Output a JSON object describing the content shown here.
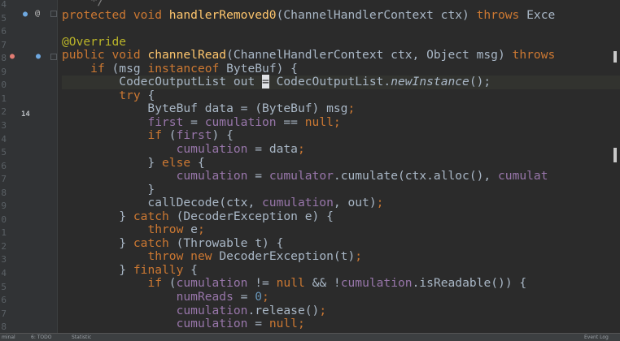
{
  "gutter": {
    "line_numbers": [
      "4",
      "5",
      "6",
      "7",
      "8",
      "9",
      "0",
      "1",
      "2",
      "3",
      "4",
      "5",
      "6",
      "7",
      "8",
      "9",
      "0",
      "1",
      "2",
      "3",
      "4",
      "5",
      "6",
      "7",
      "8"
    ],
    "badge": "14"
  },
  "code": {
    "lines": [
      [
        {
          "t": "    */",
          "c": "cm"
        }
      ],
      [
        {
          "t": "protected void ",
          "c": "kw"
        },
        {
          "t": "handlerRemoved0",
          "c": "fn"
        },
        {
          "t": "(ChannelHandlerContext ctx) "
        },
        {
          "t": "throws ",
          "c": "kw"
        },
        {
          "t": "Exce"
        }
      ],
      [],
      [
        {
          "t": "@Override",
          "c": "ann"
        }
      ],
      [
        {
          "t": "public void ",
          "c": "kw"
        },
        {
          "t": "channelRead",
          "c": "fn"
        },
        {
          "t": "(ChannelHandlerContext ctx, Object msg) "
        },
        {
          "t": "throws",
          "c": "kw"
        }
      ],
      [
        {
          "t": "    "
        },
        {
          "t": "if ",
          "c": "kw"
        },
        {
          "t": "(msg "
        },
        {
          "t": "instanceof ",
          "c": "kw"
        },
        {
          "t": "ByteBuf) {"
        }
      ],
      [
        {
          "t": "        CodecOutputList out "
        },
        {
          "t": "=",
          "c": "caret"
        },
        {
          "t": " CodecOutputList."
        },
        {
          "t": "newInstance",
          "c": "it"
        },
        {
          "t": "();"
        }
      ],
      [
        {
          "t": "        "
        },
        {
          "t": "try ",
          "c": "kw"
        },
        {
          "t": "{"
        }
      ],
      [
        {
          "t": "            ByteBuf data = (ByteBuf) msg"
        },
        {
          "t": ";",
          "c": "kw"
        }
      ],
      [
        {
          "t": "            "
        },
        {
          "t": "first",
          "c": "fld"
        },
        {
          "t": " = "
        },
        {
          "t": "cumulation",
          "c": "fld"
        },
        {
          "t": " == "
        },
        {
          "t": "null",
          "c": "kw"
        },
        {
          "t": ";",
          "c": "kw"
        }
      ],
      [
        {
          "t": "            "
        },
        {
          "t": "if ",
          "c": "kw"
        },
        {
          "t": "("
        },
        {
          "t": "first",
          "c": "fld"
        },
        {
          "t": ") {"
        }
      ],
      [
        {
          "t": "                "
        },
        {
          "t": "cumulation",
          "c": "fld"
        },
        {
          "t": " = data"
        },
        {
          "t": ";",
          "c": "kw"
        }
      ],
      [
        {
          "t": "            } "
        },
        {
          "t": "else ",
          "c": "kw"
        },
        {
          "t": "{"
        }
      ],
      [
        {
          "t": "                "
        },
        {
          "t": "cumulation",
          "c": "fld"
        },
        {
          "t": " = "
        },
        {
          "t": "cumulator",
          "c": "fld"
        },
        {
          "t": ".cumulate(ctx.alloc(), "
        },
        {
          "t": "cumulat",
          "c": "fld"
        }
      ],
      [
        {
          "t": "            }"
        }
      ],
      [
        {
          "t": "            callDecode(ctx, "
        },
        {
          "t": "cumulation",
          "c": "fld"
        },
        {
          "t": ", out)"
        },
        {
          "t": ";",
          "c": "kw"
        }
      ],
      [
        {
          "t": "        } "
        },
        {
          "t": "catch ",
          "c": "kw"
        },
        {
          "t": "(DecoderException e) {"
        }
      ],
      [
        {
          "t": "            "
        },
        {
          "t": "throw ",
          "c": "kw"
        },
        {
          "t": "e"
        },
        {
          "t": ";",
          "c": "kw"
        }
      ],
      [
        {
          "t": "        } "
        },
        {
          "t": "catch ",
          "c": "kw"
        },
        {
          "t": "(Throwable t) {"
        }
      ],
      [
        {
          "t": "            "
        },
        {
          "t": "throw new ",
          "c": "kw"
        },
        {
          "t": "DecoderException(t)"
        },
        {
          "t": ";",
          "c": "kw"
        }
      ],
      [
        {
          "t": "        } "
        },
        {
          "t": "finally ",
          "c": "kw"
        },
        {
          "t": "{"
        }
      ],
      [
        {
          "t": "            "
        },
        {
          "t": "if ",
          "c": "kw"
        },
        {
          "t": "("
        },
        {
          "t": "cumulation",
          "c": "fld"
        },
        {
          "t": " != "
        },
        {
          "t": "null ",
          "c": "kw"
        },
        {
          "t": "&& !"
        },
        {
          "t": "cumulation",
          "c": "fld"
        },
        {
          "t": ".isReadable()) {"
        }
      ],
      [
        {
          "t": "                "
        },
        {
          "t": "numReads",
          "c": "fld"
        },
        {
          "t": " = "
        },
        {
          "t": "0",
          "c": "num"
        },
        {
          "t": ";",
          "c": "kw"
        }
      ],
      [
        {
          "t": "                "
        },
        {
          "t": "cumulation",
          "c": "fld"
        },
        {
          "t": ".release()"
        },
        {
          "t": ";",
          "c": "kw"
        }
      ],
      [
        {
          "t": "                "
        },
        {
          "t": "cumulation",
          "c": "fld"
        },
        {
          "t": " = "
        },
        {
          "t": "null",
          "c": "kw"
        },
        {
          "t": ";",
          "c": "kw"
        }
      ]
    ]
  },
  "statusbar": {
    "left_items": [
      "minal",
      "6: TODO",
      "Statistic"
    ],
    "right_items": [
      "Event Log"
    ]
  }
}
